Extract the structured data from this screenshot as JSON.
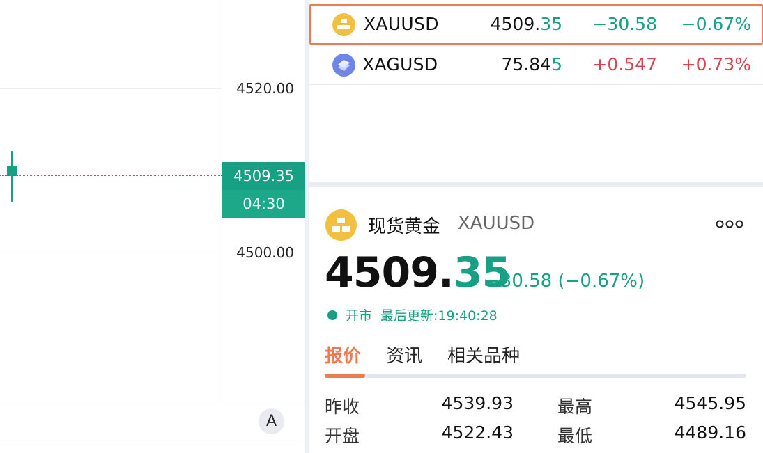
{
  "chart": {
    "axis_labels": [
      "4520.00",
      "4500.00"
    ],
    "current_price": "4509.35",
    "countdown": "04:30",
    "auto_scale_label": "A",
    "colors": {
      "up": "#e0404e",
      "down": "#17a184"
    }
  },
  "watchlist": {
    "rows": [
      {
        "icon": "gold-bars-icon",
        "symbol": "XAUUSD",
        "price_main": "4509.",
        "price_tail": "35",
        "change": "−30.58",
        "change_pct": "−0.67%",
        "direction": "down",
        "selected": true
      },
      {
        "icon": "silver-bars-icon",
        "symbol": "XAGUSD",
        "price_main": "75.84",
        "price_tail": "5",
        "change": "+0.547",
        "change_pct": "+0.73%",
        "direction": "up",
        "selected": false
      }
    ]
  },
  "detail": {
    "icon": "gold-bars-icon",
    "name": "现货黄金",
    "symbol": "XAUUSD",
    "more_icon": "more-dots-icon",
    "price_main": "4509.",
    "price_tail": "35",
    "change_text": "−30.58 (−0.67%)",
    "status": "开市",
    "last_update": "最后更新:19:40:28",
    "tabs": [
      "报价",
      "资讯",
      "相关品种"
    ],
    "active_tab": 0,
    "quotes": {
      "prev_close_label": "昨收",
      "prev_close": "4539.93",
      "high_label": "最高",
      "high": "4545.95",
      "open_label": "开盘",
      "open": "4522.43",
      "low_label": "最低",
      "low": "4489.16"
    }
  }
}
